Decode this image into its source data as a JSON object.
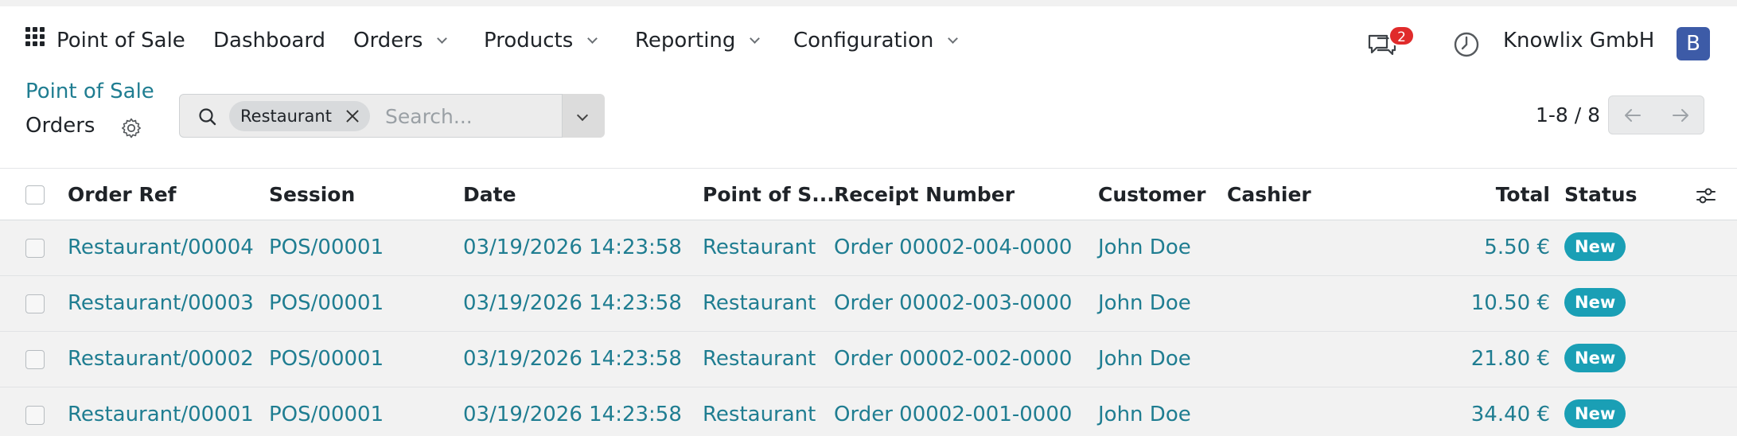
{
  "navbar": {
    "app_name": "Point of Sale",
    "menus": [
      {
        "label": "Dashboard",
        "has_dropdown": false
      },
      {
        "label": "Orders",
        "has_dropdown": true
      },
      {
        "label": "Products",
        "has_dropdown": true
      },
      {
        "label": "Reporting",
        "has_dropdown": true
      },
      {
        "label": "Configuration",
        "has_dropdown": true
      }
    ],
    "messages_count": "2",
    "company": "Knowlix GmbH",
    "user_initial": "B",
    "icons": [
      "apps-grid-icon",
      "chat-icon",
      "clock-icon"
    ],
    "colors": {
      "badge": "#e02b2b",
      "avatar": "#3d5ba7"
    }
  },
  "control_panel": {
    "breadcrumb": "Point of Sale",
    "title": "Orders",
    "search": {
      "facet": "Restaurant",
      "placeholder": "Search...",
      "value": ""
    },
    "pager": "1-8 / 8"
  },
  "table": {
    "columns": [
      "Order Ref",
      "Session",
      "Date",
      "Point of S...",
      "Receipt Number",
      "Customer",
      "Cashier",
      "Total",
      "Status"
    ],
    "rows": [
      {
        "order_ref": "Restaurant/00004",
        "session": "POS/00001",
        "date": "03/19/2026 14:23:58",
        "pos": "Restaurant",
        "receipt": "Order 00002-004-0000",
        "customer": "John Doe",
        "cashier": "",
        "total": "5.50 €",
        "status": "New"
      },
      {
        "order_ref": "Restaurant/00003",
        "session": "POS/00001",
        "date": "03/19/2026 14:23:58",
        "pos": "Restaurant",
        "receipt": "Order 00002-003-0000",
        "customer": "John Doe",
        "cashier": "",
        "total": "10.50 €",
        "status": "New"
      },
      {
        "order_ref": "Restaurant/00002",
        "session": "POS/00001",
        "date": "03/19/2026 14:23:58",
        "pos": "Restaurant",
        "receipt": "Order 00002-002-0000",
        "customer": "John Doe",
        "cashier": "",
        "total": "21.80 €",
        "status": "New"
      },
      {
        "order_ref": "Restaurant/00001",
        "session": "POS/00001",
        "date": "03/19/2026 14:23:58",
        "pos": "Restaurant",
        "receipt": "Order 00002-001-0000",
        "customer": "John Doe",
        "cashier": "",
        "total": "34.40 €",
        "status": "New"
      }
    ],
    "colors": {
      "link": "#1f7d91",
      "status_badge": "#1a9fb5"
    }
  }
}
